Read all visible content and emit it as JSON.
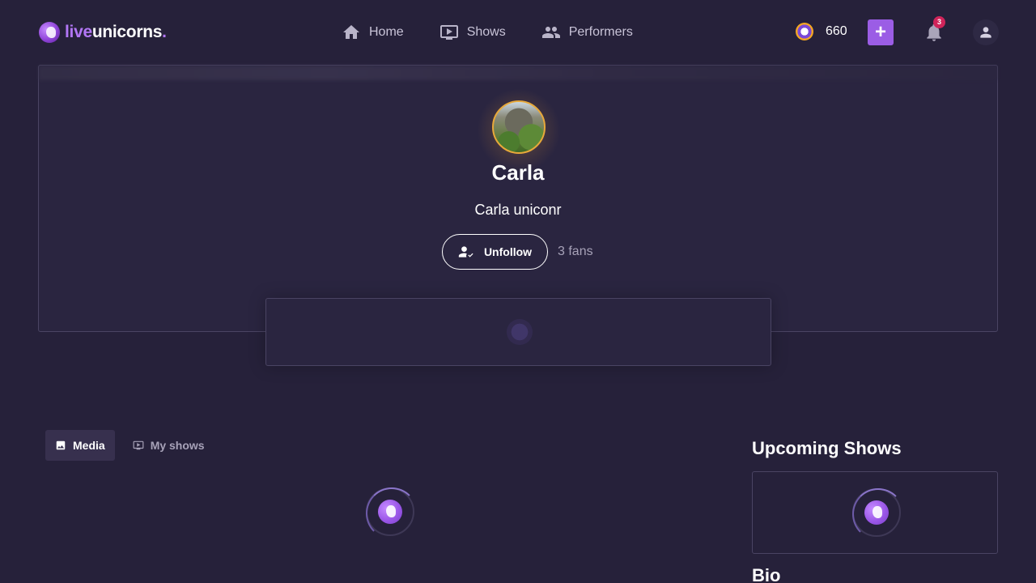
{
  "nav": {
    "logo_live": "live",
    "logo_unicorns": "unicorns",
    "logo_dot": ".",
    "links": [
      {
        "label": "Home",
        "icon": "home-icon"
      },
      {
        "label": "Shows",
        "icon": "tv-icon"
      },
      {
        "label": "Performers",
        "icon": "people-icon"
      }
    ],
    "coins": "660",
    "add_label": "+",
    "notifications_count": "3",
    "accent_color": "#9b5de5"
  },
  "profile": {
    "name": "Carla",
    "handle": "Carla uniconr",
    "follow_button_label": "Unfollow",
    "fans_text": "3 fans"
  },
  "tabs": [
    {
      "label": "Media",
      "icon": "image-icon",
      "active": true
    },
    {
      "label": "My shows",
      "icon": "tv-icon",
      "active": false
    }
  ],
  "sidebar": {
    "upcoming_title": "Upcoming Shows",
    "bio_title": "Bio"
  }
}
